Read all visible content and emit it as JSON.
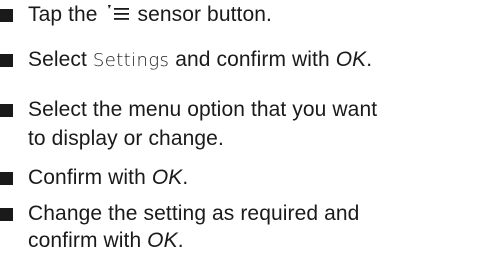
{
  "steps": [
    {
      "prefix": "Tap the",
      "icon": "sensor-menu-icon",
      "suffix": "sensor button."
    },
    {
      "prefix": "Select",
      "ui_word": "Settings",
      "middle": "and confirm with",
      "em": "OK",
      "suffix": "."
    },
    {
      "line1": "Select the menu option that you want",
      "line2": "to display or change."
    },
    {
      "prefix": "Confirm with",
      "em": "OK",
      "suffix": "."
    },
    {
      "line1": "Change the setting as required and",
      "line2_prefix": "confirm with",
      "em": "OK",
      "suffix": "."
    }
  ]
}
